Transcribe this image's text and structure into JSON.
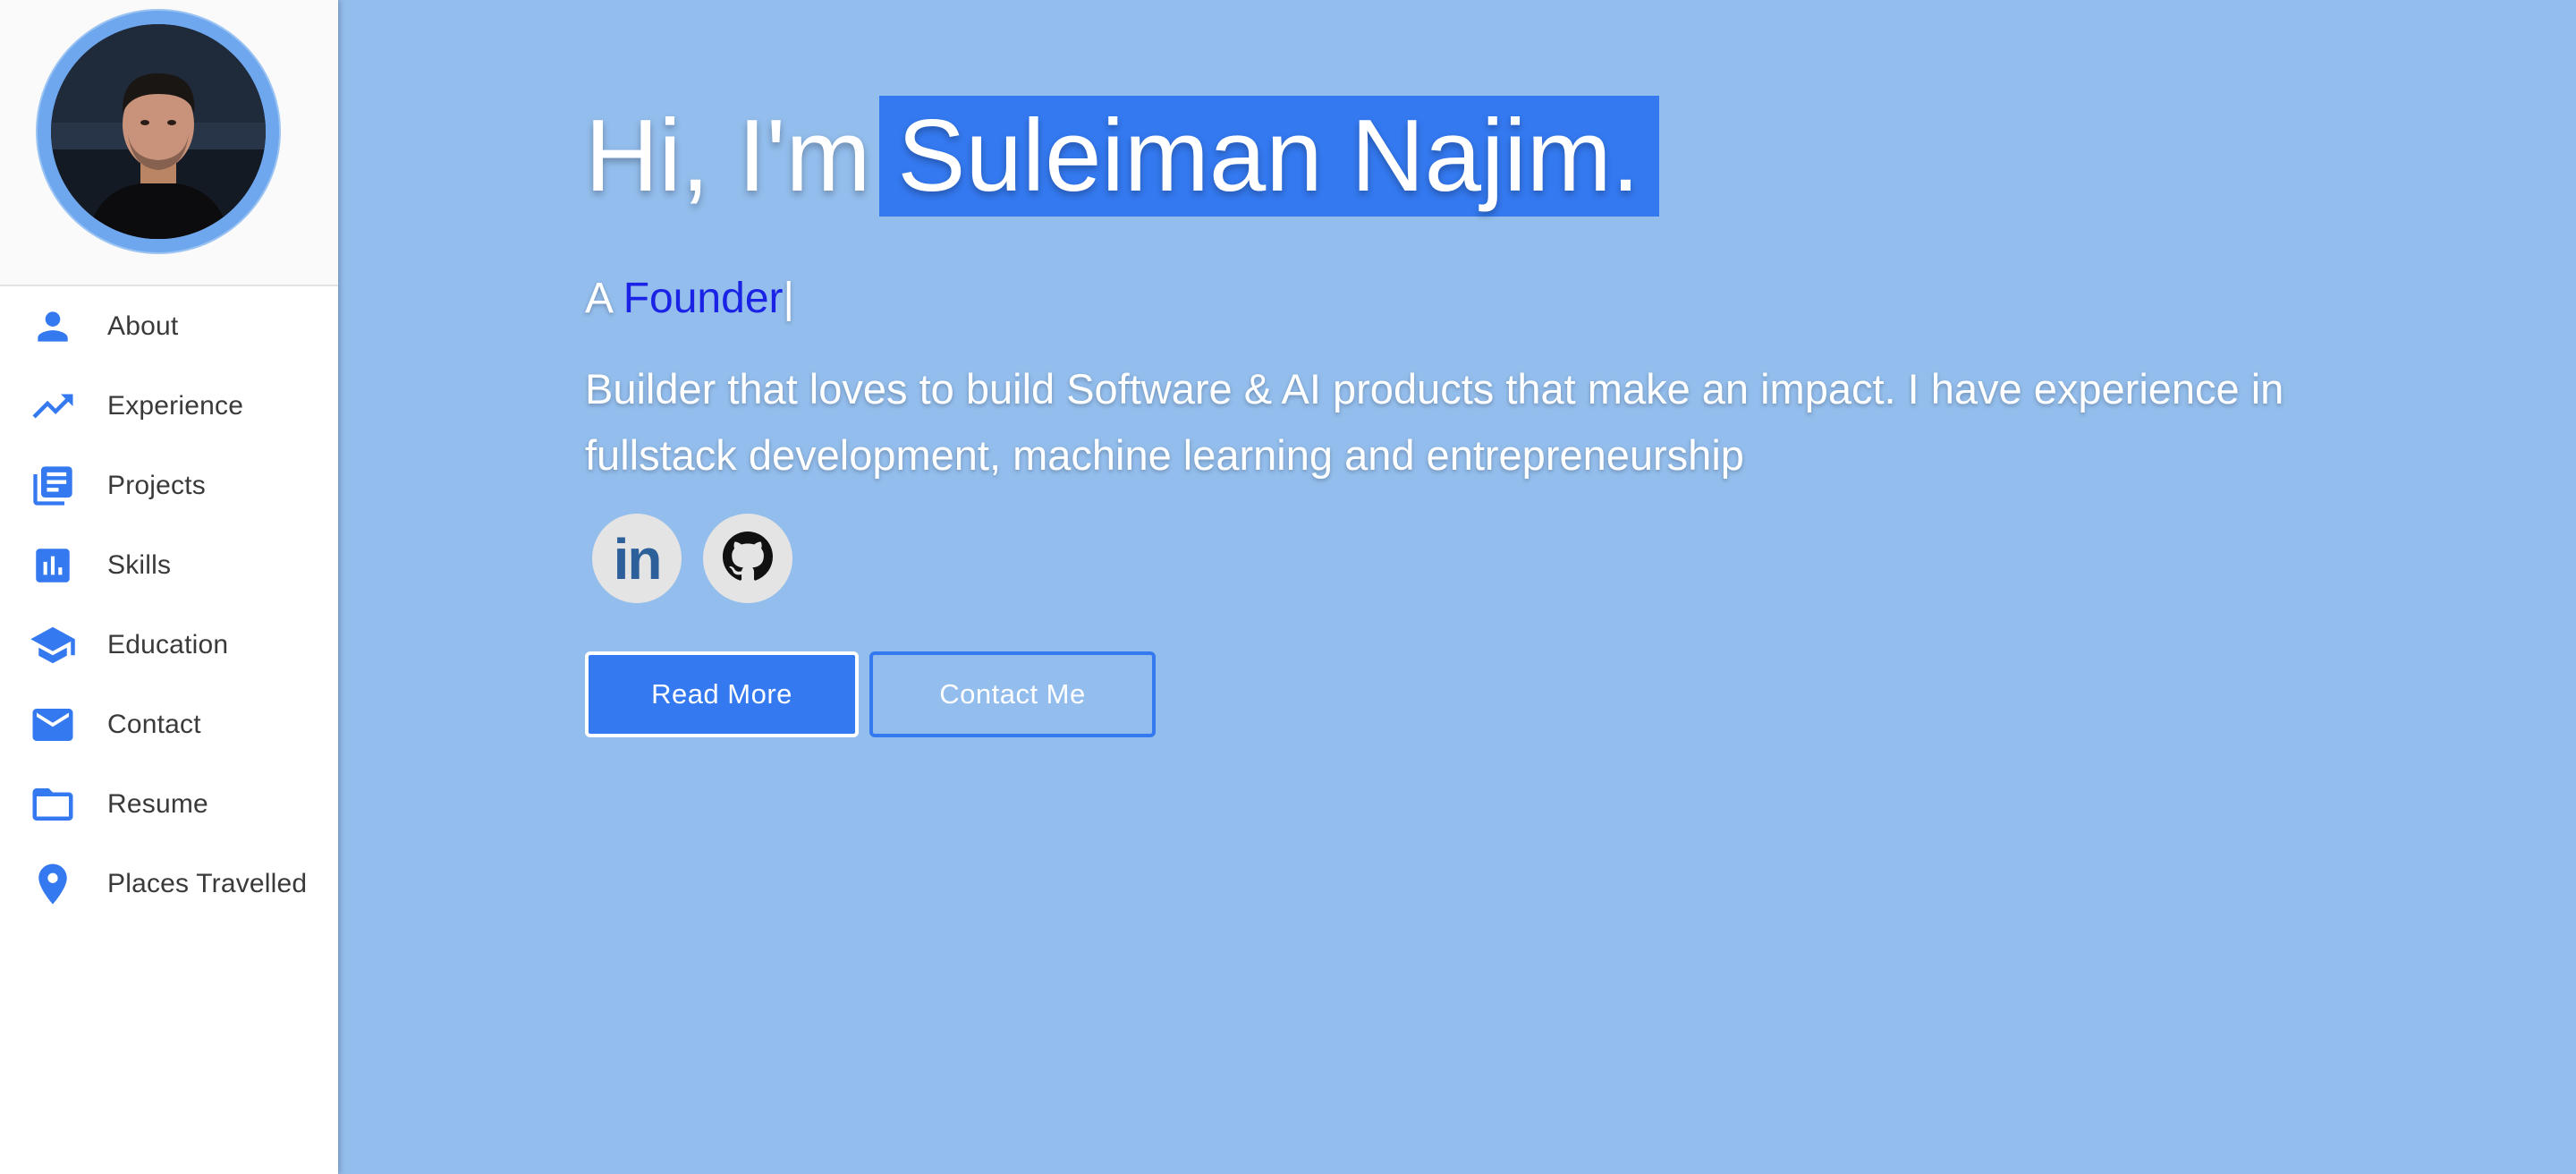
{
  "sidebar": {
    "items": [
      {
        "label": "About",
        "icon": "person-icon"
      },
      {
        "label": "Experience",
        "icon": "trending-up-icon"
      },
      {
        "label": "Projects",
        "icon": "library-books-icon"
      },
      {
        "label": "Skills",
        "icon": "bar-chart-icon"
      },
      {
        "label": "Education",
        "icon": "graduation-cap-icon"
      },
      {
        "label": "Contact",
        "icon": "mail-icon"
      },
      {
        "label": "Resume",
        "icon": "folder-icon"
      },
      {
        "label": "Places Travelled",
        "icon": "location-pin-icon"
      }
    ]
  },
  "hero": {
    "greeting": "Hi, I'm",
    "name": "Suleiman Najim.",
    "tagline_prefix": "A",
    "tagline_role": "Founder",
    "tagline_cursor": "|",
    "bio": "Builder that loves to build Software & AI products that make an impact. I have experience in fullstack development, machine learning and entrepreneurship",
    "socials": [
      {
        "name": "linkedin",
        "glyph": "in"
      },
      {
        "name": "github",
        "glyph": ""
      }
    ],
    "primary_button": "Read More",
    "secondary_button": "Contact Me"
  },
  "colors": {
    "page_background": "#93bdec",
    "accent": "#3479f0",
    "typed_word": "#1a22e6",
    "sidebar_icon": "#3479f0"
  }
}
